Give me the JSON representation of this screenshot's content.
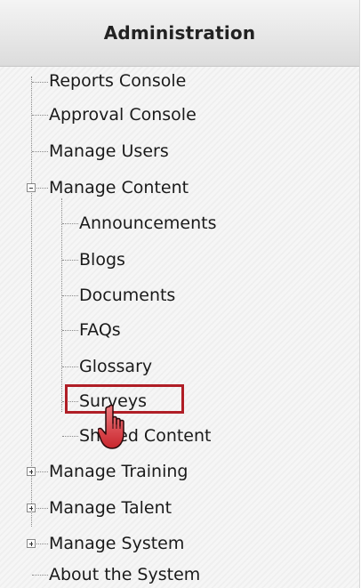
{
  "header": {
    "title": "Administration"
  },
  "tree": {
    "items": [
      {
        "label": "Reports Console"
      },
      {
        "label": "Approval Console"
      },
      {
        "label": "Manage Users"
      },
      {
        "label": "Manage Content",
        "expanded": true,
        "children": [
          {
            "label": "Announcements"
          },
          {
            "label": "Blogs"
          },
          {
            "label": "Documents"
          },
          {
            "label": "FAQs"
          },
          {
            "label": "Glossary"
          },
          {
            "label": "Surveys",
            "highlighted": true
          },
          {
            "label": "Shared Content"
          }
        ]
      },
      {
        "label": "Manage Training",
        "expanded": false
      },
      {
        "label": "Manage Talent",
        "expanded": false
      },
      {
        "label": "Manage System",
        "expanded": false
      },
      {
        "label": "About the System"
      }
    ]
  },
  "colors": {
    "highlight": "#b01e26",
    "cursor": "#d9363e"
  },
  "icons": {
    "expand": "plus-box-icon",
    "collapse": "minus-box-icon",
    "cursor": "hand-pointer-icon"
  }
}
